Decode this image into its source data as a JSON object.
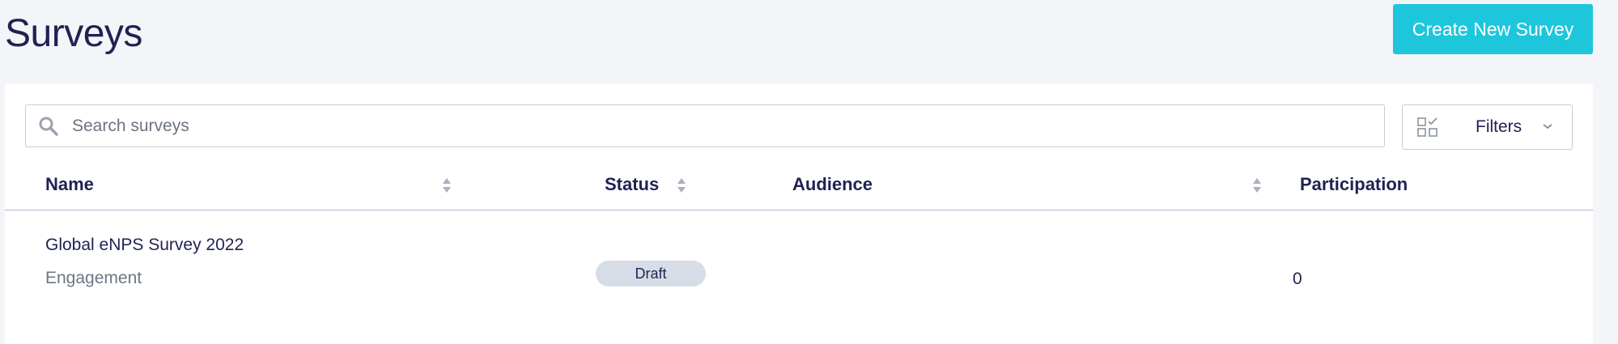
{
  "header": {
    "title": "Surveys",
    "create_button_label": "Create New Survey"
  },
  "search": {
    "placeholder": "Search surveys",
    "value": ""
  },
  "filters": {
    "label": "Filters"
  },
  "table": {
    "columns": [
      {
        "label": "Name",
        "sortable": true
      },
      {
        "label": "Status",
        "sortable": true
      },
      {
        "label": "Audience",
        "sortable": true
      },
      {
        "label": "Participation",
        "sortable": false
      }
    ],
    "rows": [
      {
        "name": "Global eNPS Survey 2022",
        "type": "Engagement",
        "status": "Draft",
        "audience": "",
        "participation": "0"
      }
    ]
  },
  "colors": {
    "accent": "#1ec6dc",
    "text_primary": "#1f2252",
    "text_secondary": "#6b7784",
    "badge_bg": "#d6dde6",
    "page_bg": "#f4f5f9",
    "border": "#c6cdd8"
  },
  "icons": {
    "search": "search-icon",
    "filters": "filter-grid-icon",
    "chevron": "chevron-down-icon",
    "sort": "sort-icon"
  }
}
